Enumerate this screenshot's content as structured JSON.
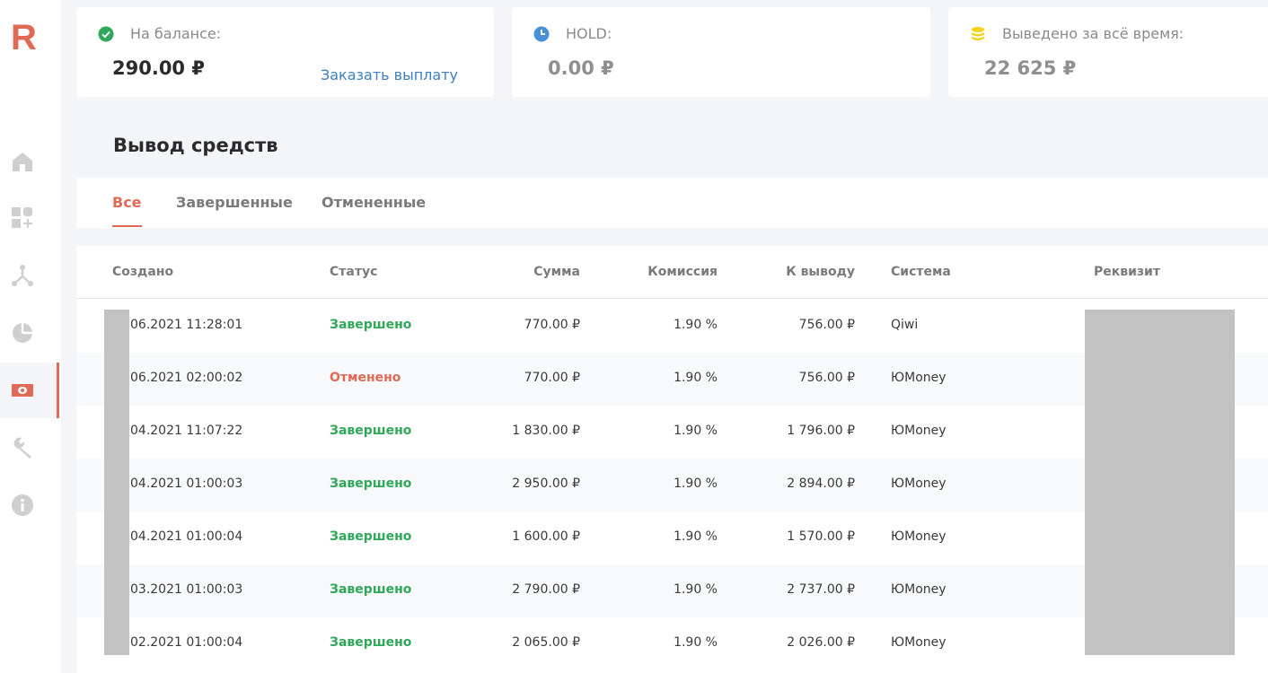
{
  "brand": {
    "logo_text": "R",
    "accent_color": "#e06a56"
  },
  "sidebar": {
    "items": [
      {
        "name": "home-icon",
        "active": false
      },
      {
        "name": "apps-add-icon",
        "active": false
      },
      {
        "name": "network-icon",
        "active": false
      },
      {
        "name": "pie-chart-icon",
        "active": false
      },
      {
        "name": "money-icon",
        "active": true
      },
      {
        "name": "wrench-icon",
        "active": false
      },
      {
        "name": "info-icon",
        "active": false
      }
    ]
  },
  "stats": {
    "balance": {
      "label": "На балансе:",
      "value": "290.00 ₽",
      "action": "Заказать выплату",
      "icon": "check-circle-icon",
      "icon_color": "#2fa85a"
    },
    "hold": {
      "label": "HOLD:",
      "value": "0.00 ₽",
      "icon": "clock-icon",
      "icon_color": "#4a90d9"
    },
    "withdrawn": {
      "label": "Выведено за всё время:",
      "value": "22 625 ₽",
      "icon": "coins-icon",
      "icon_color": "#f2d21b"
    }
  },
  "page": {
    "title": "Вывод средств"
  },
  "tabs": [
    {
      "label": "Все",
      "active": true
    },
    {
      "label": "Завершенные",
      "active": false
    },
    {
      "label": "Отмененные",
      "active": false
    }
  ],
  "table": {
    "columns": [
      "Создано",
      "Статус",
      "Сумма",
      "Комиссия",
      "К выводу",
      "Система",
      "Реквизит"
    ],
    "rows": [
      {
        "created": "06.2021 11:28:01",
        "status": "Завершено",
        "status_type": "ok",
        "amount": "770.00 ₽",
        "fee": "1.90 %",
        "payout": "756.00 ₽",
        "system": "Qiwi"
      },
      {
        "created": "06.2021 02:00:02",
        "status": "Отменено",
        "status_type": "cancel",
        "amount": "770.00 ₽",
        "fee": "1.90 %",
        "payout": "756.00 ₽",
        "system": "ЮMoney"
      },
      {
        "created": "04.2021 11:07:22",
        "status": "Завершено",
        "status_type": "ok",
        "amount": "1 830.00 ₽",
        "fee": "1.90 %",
        "payout": "1 796.00 ₽",
        "system": "ЮMoney"
      },
      {
        "created": "04.2021 01:00:03",
        "status": "Завершено",
        "status_type": "ok",
        "amount": "2 950.00 ₽",
        "fee": "1.90 %",
        "payout": "2 894.00 ₽",
        "system": "ЮMoney"
      },
      {
        "created": "04.2021 01:00:04",
        "status": "Завершено",
        "status_type": "ok",
        "amount": "1 600.00 ₽",
        "fee": "1.90 %",
        "payout": "1 570.00 ₽",
        "system": "ЮMoney"
      },
      {
        "created": "03.2021 01:00:03",
        "status": "Завершено",
        "status_type": "ok",
        "amount": "2 790.00 ₽",
        "fee": "1.90 %",
        "payout": "2 737.00 ₽",
        "system": "ЮMoney"
      },
      {
        "created": "02.2021 01:00:04",
        "status": "Завершено",
        "status_type": "ok",
        "amount": "2 065.00 ₽",
        "fee": "1.90 %",
        "payout": "2 026.00 ₽",
        "system": "ЮMoney"
      }
    ]
  }
}
